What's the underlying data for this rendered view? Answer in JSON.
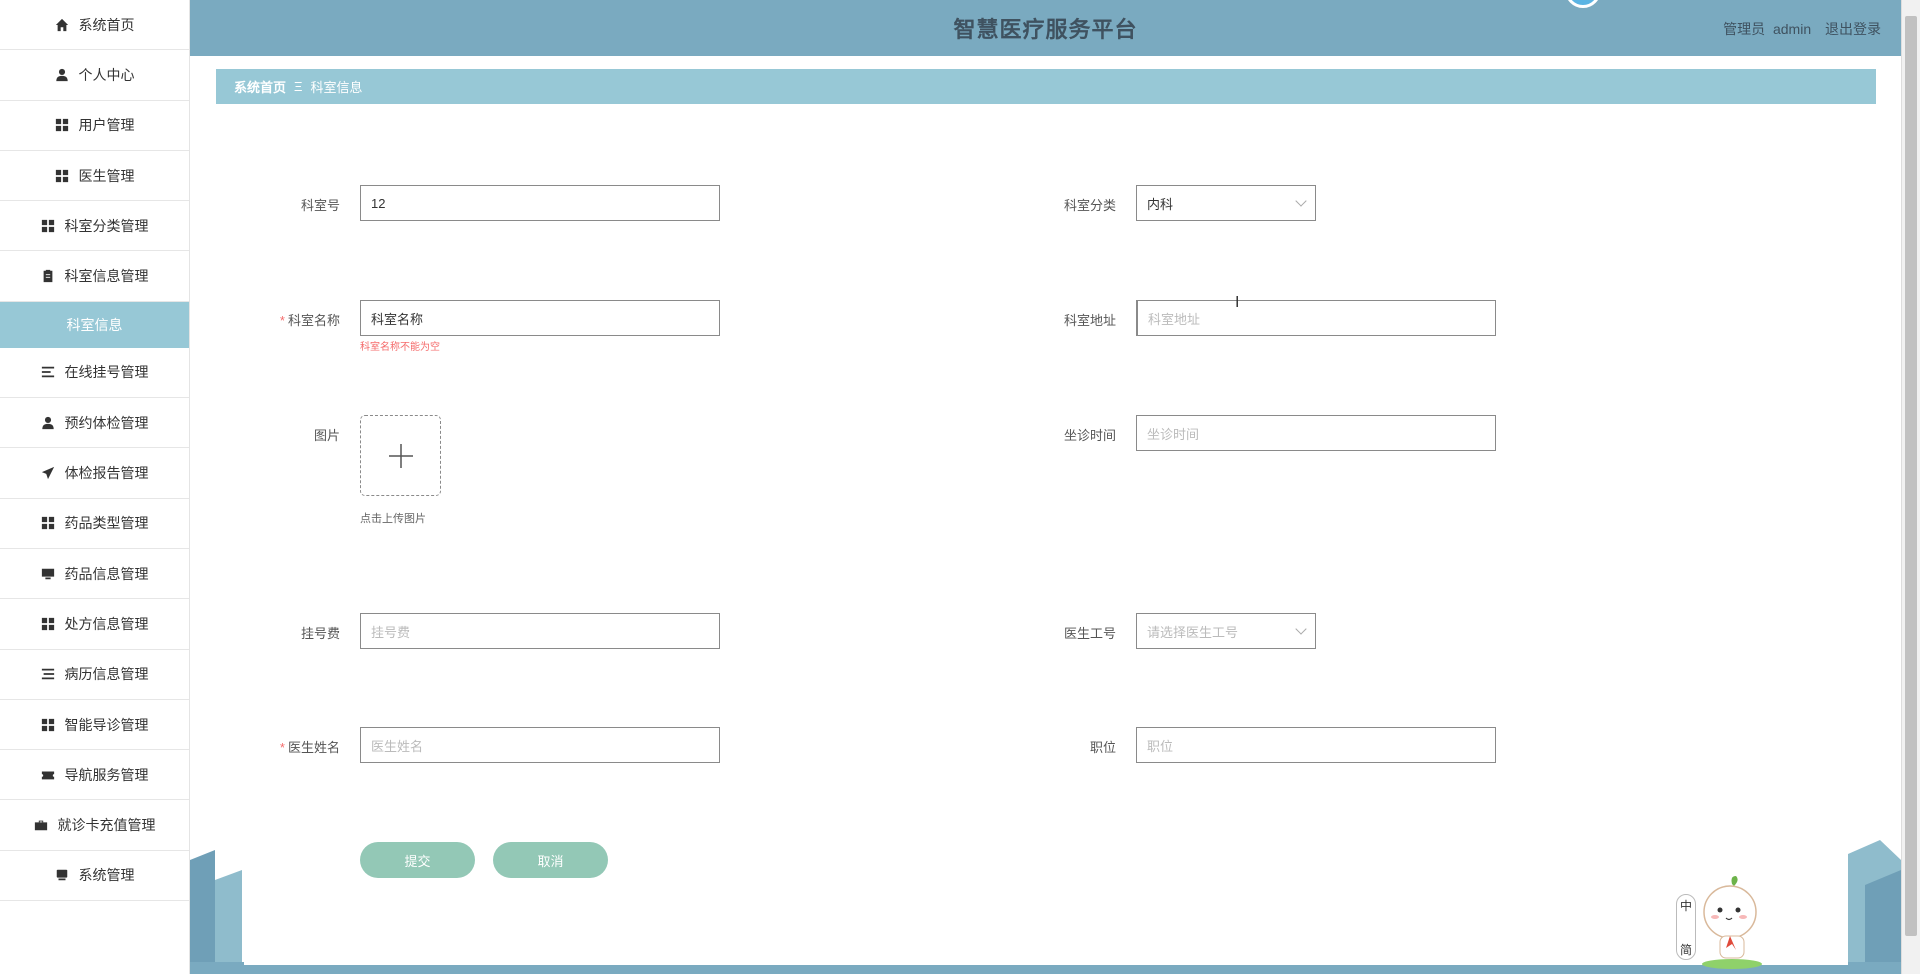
{
  "header": {
    "title": "智慧医疗服务平台",
    "user_role": "管理员",
    "username": "admin",
    "logout": "退出登录"
  },
  "sidebar": {
    "items": [
      {
        "label": "系统首页",
        "icon": "home-icon"
      },
      {
        "label": "个人中心",
        "icon": "user-icon"
      },
      {
        "label": "用户管理",
        "icon": "grid-icon"
      },
      {
        "label": "医生管理",
        "icon": "grid-icon"
      },
      {
        "label": "科室分类管理",
        "icon": "grid-icon"
      },
      {
        "label": "科室信息管理",
        "icon": "clipboard-icon"
      },
      {
        "label": "在线挂号管理",
        "icon": "list-icon"
      },
      {
        "label": "预约体检管理",
        "icon": "user-icon"
      },
      {
        "label": "体检报告管理",
        "icon": "send-icon"
      },
      {
        "label": "药品类型管理",
        "icon": "grid-icon"
      },
      {
        "label": "药品信息管理",
        "icon": "monitor-icon"
      },
      {
        "label": "处方信息管理",
        "icon": "grid-icon"
      },
      {
        "label": "病历信息管理",
        "icon": "list-icon"
      },
      {
        "label": "智能导诊管理",
        "icon": "grid-icon"
      },
      {
        "label": "导航服务管理",
        "icon": "ticket-icon"
      },
      {
        "label": "就诊卡充值管理",
        "icon": "briefcase-icon"
      },
      {
        "label": "系统管理",
        "icon": "screen-icon"
      }
    ],
    "active_sub": "科室信息"
  },
  "breadcrumb": {
    "home": "系统首页",
    "separator": "Ξ",
    "current": "科室信息"
  },
  "form": {
    "dept_no": {
      "label": "科室号",
      "value": "12"
    },
    "dept_category": {
      "label": "科室分类",
      "value": "内科"
    },
    "dept_name": {
      "label": "科室名称",
      "value": "科室名称",
      "error": "科室名称不能为空"
    },
    "dept_address": {
      "label": "科室地址",
      "placeholder": "科室地址"
    },
    "picture": {
      "label": "图片",
      "tip": "点击上传图片"
    },
    "clinic_time": {
      "label": "坐诊时间",
      "placeholder": "坐诊时间"
    },
    "reg_fee": {
      "label": "挂号费",
      "placeholder": "挂号费"
    },
    "doctor_id": {
      "label": "医生工号",
      "placeholder": "请选择医生工号"
    },
    "doctor_name": {
      "label": "医生姓名",
      "placeholder": "医生姓名"
    },
    "position": {
      "label": "职位",
      "placeholder": "职位"
    },
    "required_mark": "*",
    "submit": "提交",
    "cancel": "取消"
  },
  "mascot": {
    "chars": [
      "中",
      "简"
    ]
  },
  "colors": {
    "header": "#7aaac0",
    "breadcrumb": "#97c8d6",
    "button": "#93c8b6",
    "error": "#f56c6c"
  }
}
